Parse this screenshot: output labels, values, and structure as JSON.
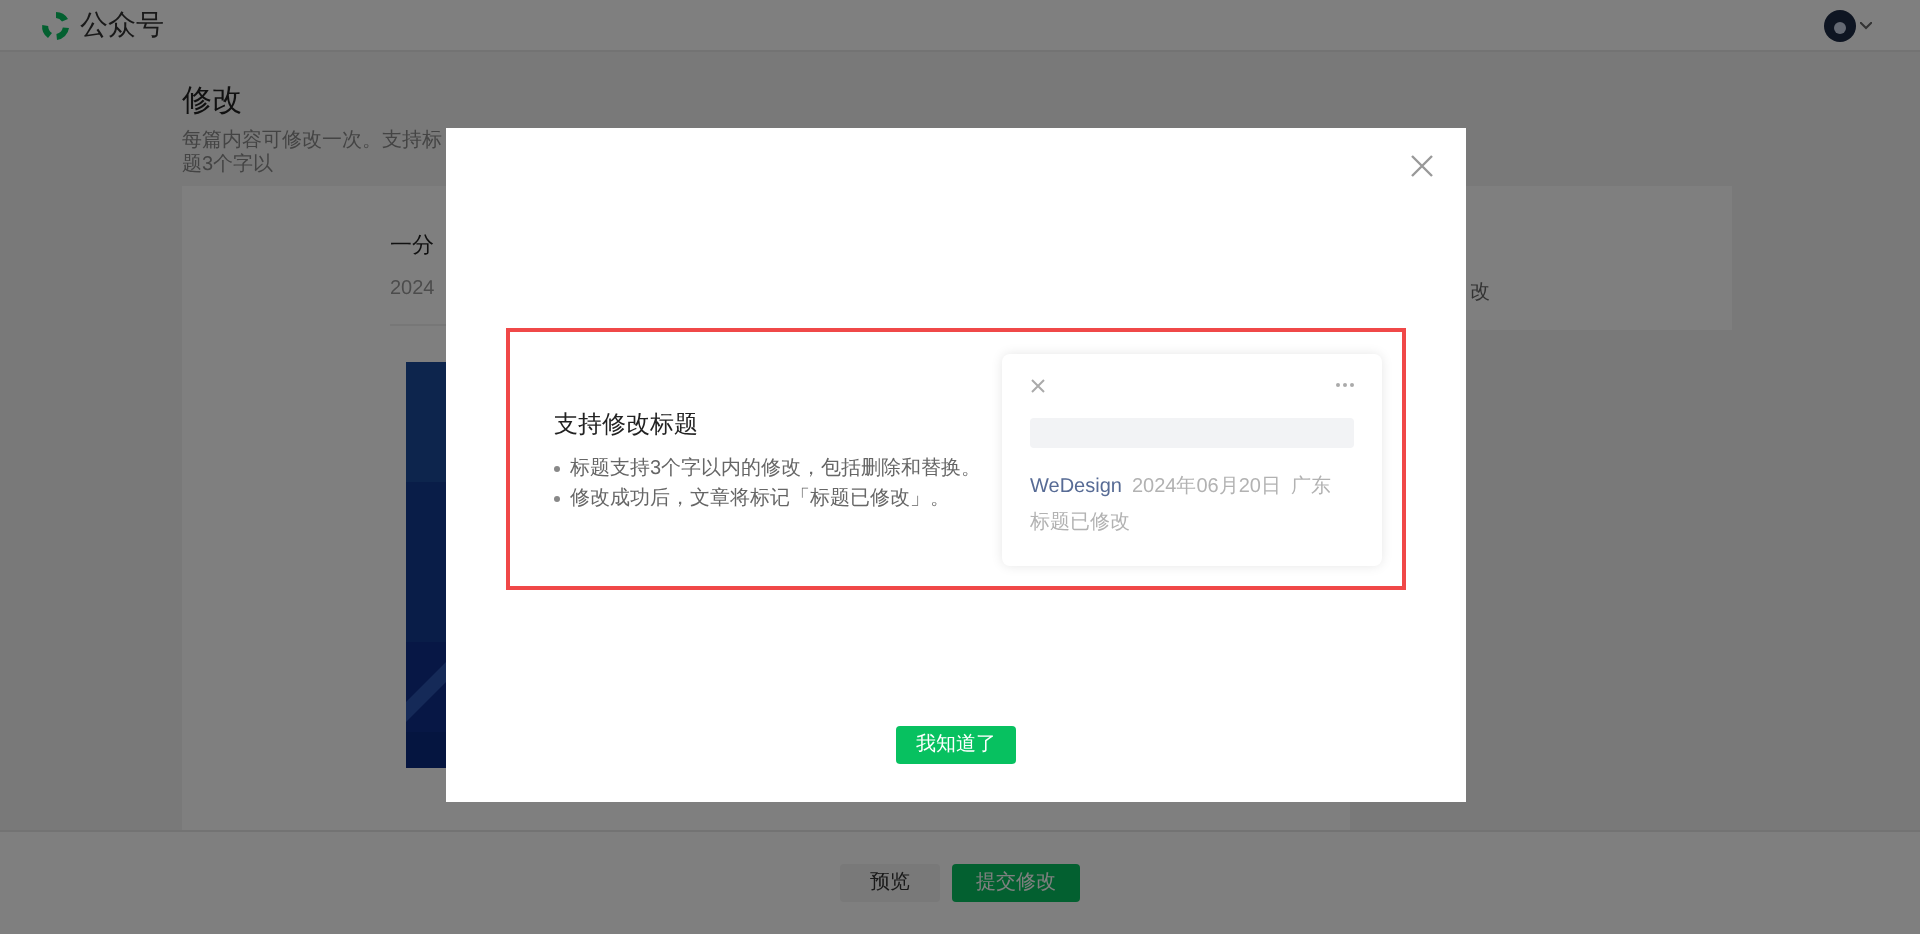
{
  "header": {
    "brand": "公众号"
  },
  "page": {
    "title": "修改",
    "subtitle": "每篇内容可修改一次。支持标题3个字以",
    "article": {
      "title": "一分",
      "date": "2024"
    },
    "side_card": {
      "text": "改"
    }
  },
  "footer": {
    "buttons": [
      {
        "label": "预览",
        "kind": "secondary"
      },
      {
        "label": "提交修改",
        "kind": "primary"
      }
    ]
  },
  "dialog": {
    "feature": {
      "title": "支持修改标题",
      "bullets": [
        "标题支持3个字以内的修改，包括删除和替换。",
        "修改成功后，文章将标记「标题已修改」。"
      ]
    },
    "preview": {
      "author": "WeDesign",
      "date": "2024年06月20日",
      "location": "广东",
      "note": "标题已修改"
    },
    "button": "我知道了"
  }
}
